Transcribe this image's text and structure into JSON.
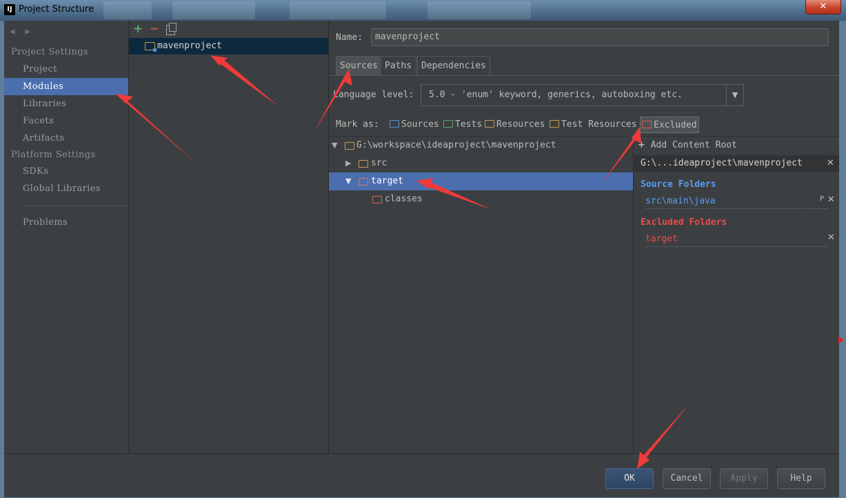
{
  "window": {
    "title": "Project Structure",
    "app_icon_text": "IJ",
    "close_label": "✕"
  },
  "leftnav": {
    "back_icon": "◂",
    "forward_icon": "▸",
    "project_settings_header": "Project Settings",
    "project_items": [
      "Project",
      "Modules",
      "Libraries",
      "Facets",
      "Artifacts"
    ],
    "platform_settings_header": "Platform Settings",
    "platform_items": [
      "SDKs",
      "Global Libraries"
    ],
    "problems": "Problems",
    "selected": "Modules"
  },
  "middle": {
    "add": "+",
    "remove": "−",
    "module_name": "mavenproject"
  },
  "right": {
    "name_label": "Name:",
    "name_value": "mavenproject",
    "tabs": [
      "Sources",
      "Paths",
      "Dependencies"
    ],
    "active_tab": "Sources",
    "language_level_label": "Language level:",
    "language_level_value": "5.0 - 'enum' keyword, generics, autoboxing etc.",
    "mark_as_label": "Mark as:",
    "mark_as": [
      {
        "label": "Sources",
        "color": "#4f8ed8"
      },
      {
        "label": "Tests",
        "color": "#59a869"
      },
      {
        "label": "Resources",
        "color": "#c69b4f"
      },
      {
        "label": "Test Resources",
        "color": "#c69b4f"
      },
      {
        "label": "Excluded",
        "color": "#d9604b"
      }
    ],
    "tree": [
      {
        "label": "G:\\workspace\\ideaproject\\mavenproject",
        "expanded": true,
        "color": "#c69b4f"
      },
      {
        "label": "src",
        "expanded": false,
        "color": "#c69b4f"
      },
      {
        "label": "target",
        "expanded": true,
        "color": "#d9604b",
        "selected": true
      },
      {
        "label": "classes",
        "color": "#d9604b"
      }
    ],
    "roots": {
      "add_content_root": "Add Content Root",
      "root_path": "G:\\...ideaproject\\mavenproject",
      "source_folders_title": "Source Folders",
      "source_folders": [
        "src\\main\\java"
      ],
      "source_folder_suffix": "P",
      "excluded_folders_title": "Excluded Folders",
      "excluded_folders": [
        "target"
      ],
      "source_color": "#589df6",
      "excluded_color": "#e64d4d"
    }
  },
  "buttons": {
    "ok": "OK",
    "cancel": "Cancel",
    "apply": "Apply",
    "help": "Help"
  }
}
